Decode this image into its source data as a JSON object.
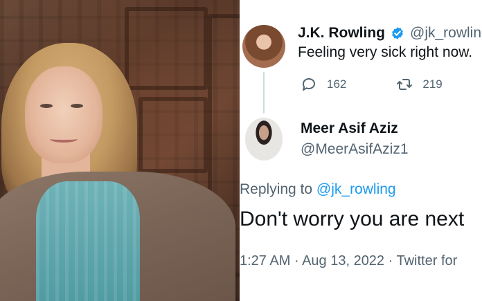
{
  "tweet": {
    "author": {
      "display_name": "J.K. Rowling",
      "handle": "@jk_rowling",
      "verified": true
    },
    "text": "Feeling very sick right now.",
    "reply_count": "162",
    "retweet_count": "219"
  },
  "reply": {
    "author": {
      "display_name": "Meer Asif Aziz",
      "handle": "@MeerAsifAziz1"
    },
    "replying_to_prefix": "Replying to ",
    "replying_to_handle": "@jk_rowling",
    "text": "Don't worry you are next",
    "time": "1:27 AM",
    "date": "Aug 13, 2022",
    "source": "Twitter for"
  },
  "colors": {
    "accent": "#1d9bf0",
    "text_primary": "#0f1419",
    "text_secondary": "#536471"
  },
  "icons": {
    "verified": "verified-badge-icon",
    "reply": "reply-bubble-icon",
    "retweet": "retweet-icon"
  }
}
